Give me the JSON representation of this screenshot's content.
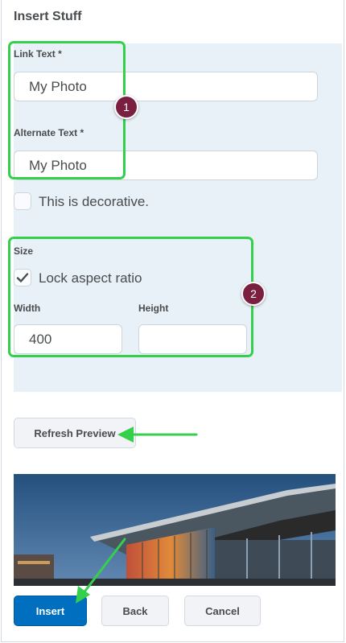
{
  "dialog": {
    "title": "Insert Stuff"
  },
  "form": {
    "link_text": {
      "label": "Link Text *",
      "value": "My Photo"
    },
    "alt_text": {
      "label": "Alternate Text *",
      "value": "My Photo"
    },
    "decorative": {
      "label": "This is decorative.",
      "checked": false
    },
    "size": {
      "heading": "Size",
      "lock_aspect": {
        "label": "Lock aspect ratio",
        "checked": true
      },
      "width": {
        "label": "Width",
        "value": "400"
      },
      "height": {
        "label": "Height",
        "value": ""
      }
    }
  },
  "buttons": {
    "refresh_preview": "Refresh Preview",
    "insert": "Insert",
    "back": "Back",
    "cancel": "Cancel"
  },
  "annotations": {
    "badge_1": "1",
    "badge_2": "2",
    "highlight_color": "#35d04b",
    "badge_color": "#7a1f3f"
  },
  "colors": {
    "primary": "#006fbf",
    "panel_bg": "#e9f1f8"
  }
}
